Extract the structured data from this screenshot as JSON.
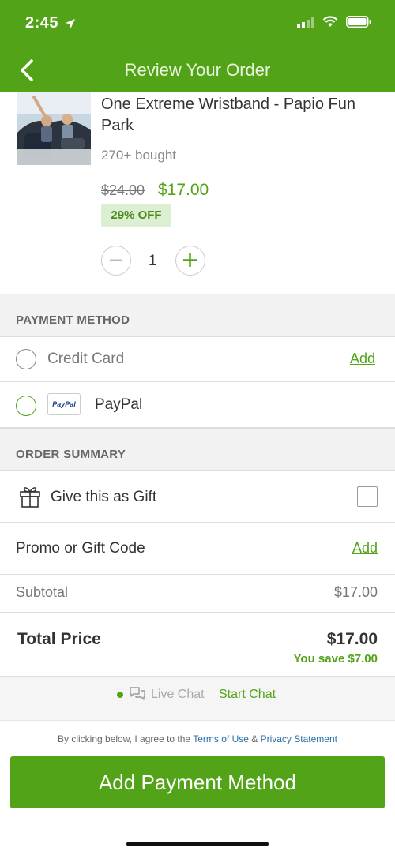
{
  "status": {
    "time": "2:45"
  },
  "nav": {
    "title": "Review Your Order"
  },
  "product": {
    "title": "One Extreme Wristband - Papio Fun Park",
    "bought": "270+ bought",
    "old_price": "$24.00",
    "new_price": "$17.00",
    "badge": "29% OFF",
    "quantity": "1"
  },
  "payment": {
    "header": "PAYMENT METHOD",
    "credit_card_label": "Credit Card",
    "credit_card_add": "Add",
    "paypal_label": "PayPal",
    "paypal_logo": "PayPal"
  },
  "summary": {
    "header": "ORDER SUMMARY",
    "gift_label": "Give this as Gift",
    "promo_label": "Promo or Gift Code",
    "promo_add": "Add",
    "subtotal_label": "Subtotal",
    "subtotal_value": "$17.00",
    "total_label": "Total Price",
    "total_value": "$17.00",
    "savings": "You save $7.00"
  },
  "chat": {
    "live_label": "Live Chat",
    "start_label": "Start Chat"
  },
  "legal": {
    "prefix": "By clicking below, I agree to the ",
    "terms": "Terms of Use",
    "amp": " & ",
    "privacy": "Privacy Statement"
  },
  "cta": {
    "label": "Add Payment Method"
  },
  "colors": {
    "brand": "#53a318",
    "link_blue": "#2a6ea8",
    "badge_bg": "#dcefd2"
  },
  "icons": [
    "location-arrow-icon",
    "signal-icon",
    "wifi-icon",
    "battery-icon",
    "back-chevron-icon",
    "minus-icon",
    "plus-icon",
    "gift-icon",
    "chat-bubbles-icon"
  ]
}
